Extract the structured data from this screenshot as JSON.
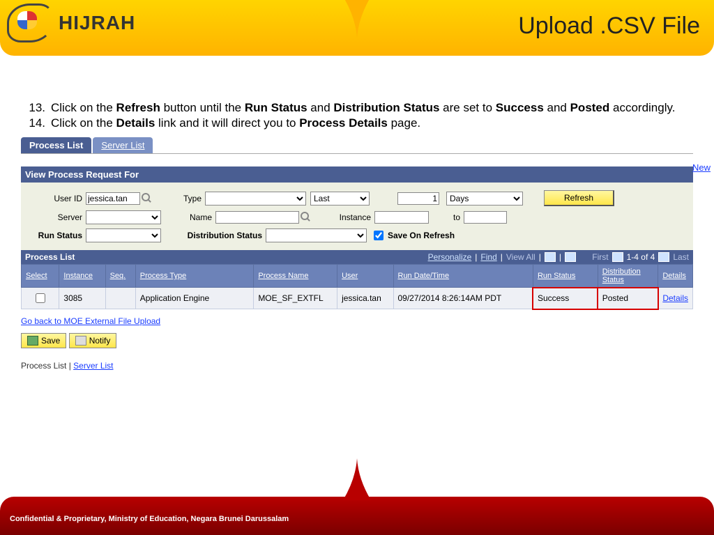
{
  "banner": {
    "logo_text": "HIJRAH",
    "title": "Upload .CSV File"
  },
  "instructions": {
    "step13": "Click on the <b>Refresh</b> button until the <b>Run Status</b> and <b>Distribution Status</b> are set to <b>Success</b> and <b>Posted</b> accordingly.",
    "step14": "Click on the <b>Details</b> link and it will direct you to <b>Process Details</b> page."
  },
  "new_link": "New",
  "tabs": {
    "process_list": "Process List",
    "server_list": "Server List"
  },
  "panel_title": "View Process Request For",
  "filters": {
    "user_id_label": "User ID",
    "user_id_value": "jessica.tan",
    "type_label": "Type",
    "type_value": "",
    "last_label": "Last",
    "last_count": "1",
    "last_unit": "Days",
    "server_label": "Server",
    "server_value": "",
    "name_label": "Name",
    "name_value": "",
    "instance_label": "Instance",
    "instance_from": "",
    "to_label": "to",
    "instance_to": "",
    "run_status_label": "Run Status",
    "run_status_value": "",
    "dist_status_label": "Distribution Status",
    "dist_status_value": "",
    "save_on_refresh": "Save On Refresh",
    "refresh_button": "Refresh"
  },
  "grid": {
    "title": "Process List",
    "links": {
      "personalize": "Personalize",
      "find": "Find",
      "view_all": "View All",
      "first": "First",
      "range": "1-4 of 4",
      "last": "Last"
    },
    "columns": [
      "Select",
      "Instance",
      "Seq.",
      "Process Type",
      "Process Name",
      "User",
      "Run Date/Time",
      "Run Status",
      "Distribution Status",
      "Details"
    ],
    "row": {
      "instance": "3085",
      "seq": "",
      "process_type": "Application Engine",
      "process_name": "MOE_SF_EXTFL",
      "user": "jessica.tan",
      "run_datetime": "09/27/2014  8:26:14AM PDT",
      "run_status": "Success",
      "dist_status": "Posted",
      "details": "Details"
    }
  },
  "back_link": "Go back to MOE External File Upload",
  "buttons": {
    "save": "Save",
    "notify": "Notify"
  },
  "bottom": {
    "process_list": "Process List",
    "sep": " | ",
    "server_list": "Server List"
  },
  "footer": "Confidential & Proprietary, Ministry of Education, Negara Brunei Darussalam"
}
